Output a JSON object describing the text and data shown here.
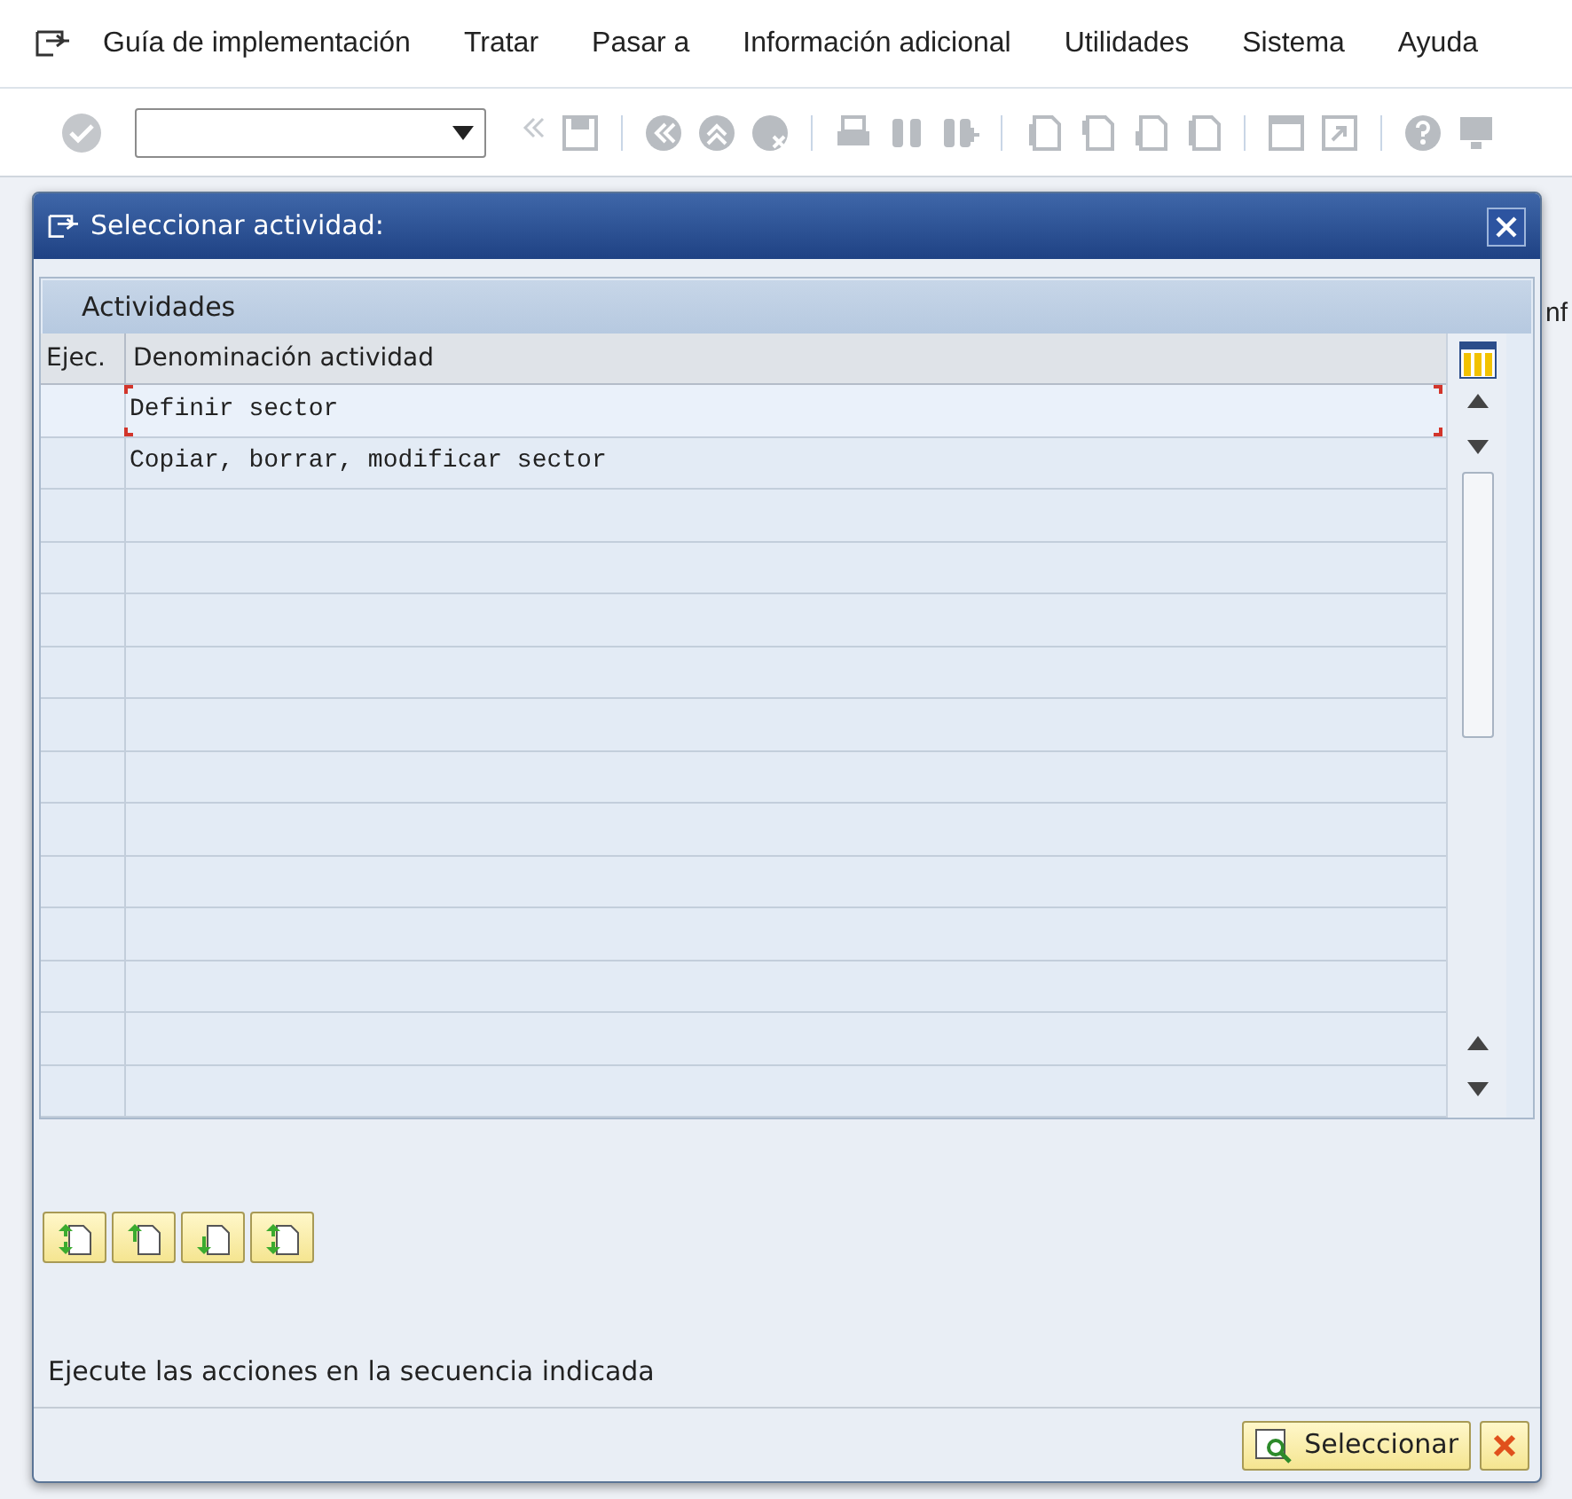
{
  "menu": [
    {
      "label": "Guía de implementación"
    },
    {
      "label": "Tratar"
    },
    {
      "label": "Pasar a"
    },
    {
      "label": "Información adicional"
    },
    {
      "label": "Utilidades"
    },
    {
      "label": "Sistema"
    },
    {
      "label": "Ayuda"
    }
  ],
  "background_text": "nf",
  "dialog": {
    "title": "Seleccionar actividad:",
    "table": {
      "title": "Actividades",
      "columns": [
        "Ejec.",
        "Denominación actividad"
      ],
      "rows": [
        {
          "cells": [
            "",
            "Definir sector"
          ],
          "selected": true
        },
        {
          "cells": [
            "",
            "Copiar, borrar, modificar sector"
          ],
          "selected": false
        }
      ]
    },
    "message": "Ejecute las acciones en la secuencia indicada",
    "select_button": "Seleccionar"
  }
}
